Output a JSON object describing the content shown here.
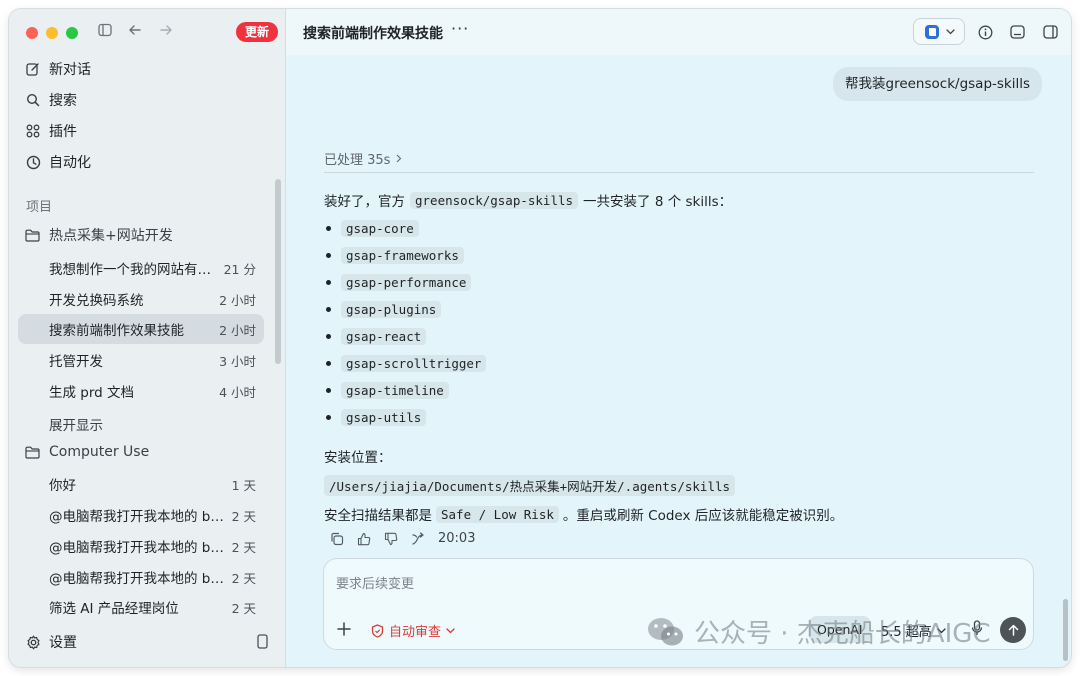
{
  "sidebar": {
    "update_badge": "更新",
    "nav": [
      {
        "label": "新对话",
        "icon": "edit-icon"
      },
      {
        "label": "搜索",
        "icon": "search-icon"
      },
      {
        "label": "插件",
        "icon": "plugins-icon"
      },
      {
        "label": "自动化",
        "icon": "clock-icon"
      }
    ],
    "projects_label": "项目",
    "folders": [
      {
        "name": "热点采集+网站开发",
        "threads": [
          {
            "title": "我想制作一个我的网站有很多…",
            "time": "21 分"
          },
          {
            "title": "开发兑换码系统",
            "time": "2 小时"
          },
          {
            "title": "搜索前端制作效果技能",
            "time": "2 小时"
          },
          {
            "title": "托管开发",
            "time": "3 小时"
          },
          {
            "title": "生成 prd 文档",
            "time": "4 小时"
          }
        ],
        "expand_label": "展开显示"
      },
      {
        "name": "Computer Use",
        "threads": [
          {
            "title": "你好",
            "time": "1 天"
          },
          {
            "title": "@电脑帮我打开我本地的 bo…",
            "time": "2 天"
          },
          {
            "title": "@电脑帮我打开我本地的 bo…",
            "time": "2 天"
          },
          {
            "title": "@电脑帮我打开我本地的 bo…",
            "time": "2 天"
          },
          {
            "title": "筛选 AI 产品经理岗位",
            "time": "2 天"
          }
        ]
      }
    ],
    "settings_label": "设置"
  },
  "header": {
    "title": "搜索前端制作效果技能",
    "more": "···"
  },
  "conversation": {
    "user_message": "帮我装greensock/gsap-skills",
    "processed": "已处理 35s",
    "reply": {
      "intro_pre": "装好了，官方",
      "intro_code": "greensock/gsap-skills",
      "intro_post": "一共安装了 8 个 skills：",
      "skills": [
        "gsap-core",
        "gsap-frameworks",
        "gsap-performance",
        "gsap-plugins",
        "gsap-react",
        "gsap-scrolltrigger",
        "gsap-timeline",
        "gsap-utils"
      ],
      "location_label": "安装位置：",
      "location_path": "/Users/jiajia/Documents/热点采集+网站开发/.agents/skills",
      "scan_pre": "安全扫描结果都是",
      "scan_code": "Safe / Low Risk",
      "scan_post": "。重启或刷新 Codex 后应该就能稳定被识别。"
    },
    "timestamp": "20:03"
  },
  "composer": {
    "placeholder": "要求后续变更",
    "auto_review": "自动审查",
    "model": "OpenAI",
    "version": "5.5 超高"
  },
  "watermark": {
    "text": "公众号 · 杰克船长的AIGC"
  }
}
